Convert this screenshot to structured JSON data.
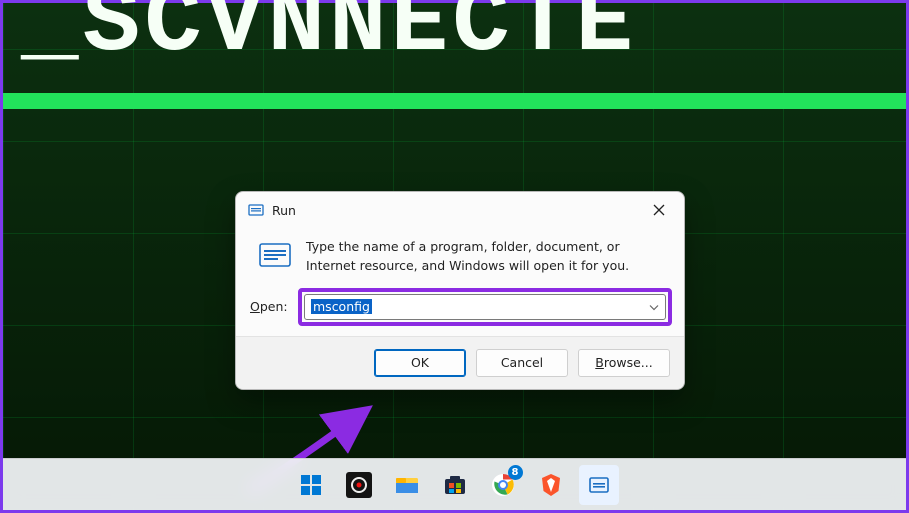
{
  "desktop": {
    "wallpaper_text": "_SCVNNECTE"
  },
  "run_dialog": {
    "title": "Run",
    "description": "Type the name of a program, folder, document, or Internet resource, and Windows will open it for you.",
    "open_label_prefix": "O",
    "open_label_suffix": "pen:",
    "input_value": "msconfig",
    "buttons": {
      "ok": "OK",
      "cancel": "Cancel",
      "browse_prefix": "B",
      "browse_suffix": "rowse..."
    }
  },
  "taskbar": {
    "chrome_badge": "8"
  }
}
